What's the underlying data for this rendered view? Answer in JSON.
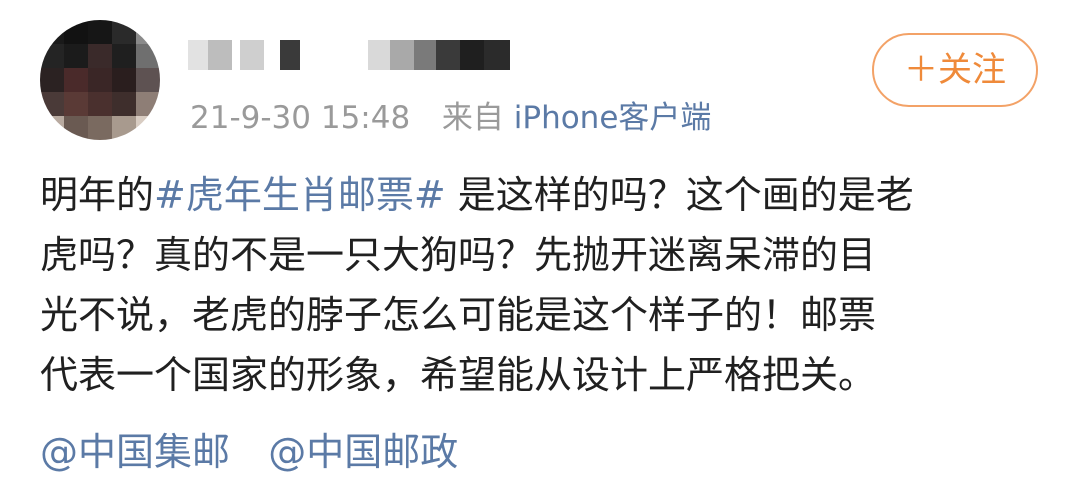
{
  "post": {
    "meta": {
      "timestamp": "21-9-30 15:48",
      "source_prefix": "来自",
      "source_device": "iPhone客户端"
    },
    "follow_button": {
      "label": "＋关注"
    },
    "body_lines": [
      {
        "before": "明年的",
        "hashtag": "#虎年生肖邮票#",
        "after": " 是这样的吗？这个画的是老"
      },
      {
        "text": "虎吗？真的不是一只大狗吗？先抛开迷离呆滞的目"
      },
      {
        "text": "光不说，老虎的脖子怎么可能是这个样子的！邮票"
      },
      {
        "text": "代表一个国家的形象，希望能从设计上严格把关。"
      }
    ],
    "mentions": [
      "@中国集邮",
      "@中国邮政"
    ],
    "colors": {
      "link": "#5b7aa6",
      "follow_accent": "#ef8a3a",
      "meta_gray": "#9a9a9a",
      "body_text": "#202020"
    }
  }
}
